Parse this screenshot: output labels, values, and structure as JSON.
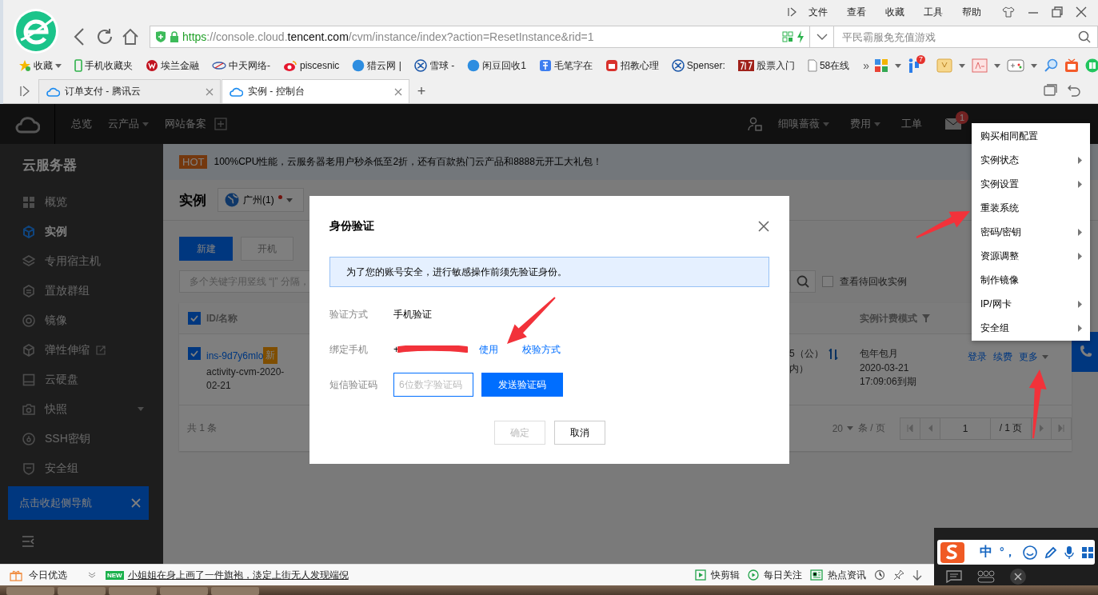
{
  "browser": {
    "menu": [
      "文件",
      "查看",
      "收藏",
      "工具",
      "帮助"
    ],
    "address": [
      {
        "kind": "scheme",
        "text": "https"
      },
      {
        "kind": "path",
        "text": "://console.cloud."
      },
      {
        "kind": "domain",
        "text": "tencent.com"
      },
      {
        "kind": "path",
        "text": "/cvm/instance/index?action=ResetInstance&rid=1"
      }
    ],
    "search": {
      "placeholder": "平民霸服免充值游戏"
    },
    "bookmarks": [
      {
        "label": "收藏"
      },
      {
        "label": "手机收藏夹"
      },
      {
        "label": "埃兰金融"
      },
      {
        "label": "中天网络-"
      },
      {
        "label": "piscesnic"
      },
      {
        "label": "猎云网 |"
      },
      {
        "label": "雪球 -"
      },
      {
        "label": "闲豆回收1"
      },
      {
        "label": "毛笔字在"
      },
      {
        "label": "招教心理"
      },
      {
        "label": "Spenser:"
      },
      {
        "label": "股票入门"
      },
      {
        "label": "58在线"
      }
    ],
    "bookmarks_more": "»",
    "app_badge": "7",
    "tabs": [
      {
        "label": "订单支付 - 腾讯云",
        "selected": false
      },
      {
        "label": "实例 - 控制台",
        "selected": true
      }
    ],
    "new_tab": "+"
  },
  "console": {
    "nav": [
      {
        "label": "总览",
        "dropdown": false
      },
      {
        "label": "云产品",
        "dropdown": true
      },
      {
        "label": "网站备案",
        "dropdown": false
      }
    ],
    "nav_right": [
      {
        "label": "细嗅蔷薇",
        "dropdown": true
      },
      {
        "label": "费用",
        "dropdown": true
      },
      {
        "label": "工单",
        "dropdown": false
      }
    ],
    "mail_badge": "1",
    "sidebar": {
      "title": "云服务器",
      "tooltip": "点击收起侧导航",
      "items": [
        {
          "label": "概览",
          "kind": "plain",
          "selected": false
        },
        {
          "label": "实例",
          "kind": "plain",
          "selected": true
        },
        {
          "label": "专用宿主机",
          "kind": "plain",
          "selected": false
        },
        {
          "label": "置放群组",
          "kind": "plain",
          "selected": false
        },
        {
          "label": "镜像",
          "kind": "plain",
          "selected": false
        },
        {
          "label": "弹性伸缩",
          "kind": "external",
          "selected": false
        },
        {
          "label": "云硬盘",
          "kind": "plain",
          "selected": false
        },
        {
          "label": "快照",
          "kind": "expandable",
          "selected": false
        },
        {
          "label": "SSH密钥",
          "kind": "plain",
          "selected": false
        },
        {
          "label": "安全组",
          "kind": "plain",
          "selected": false
        }
      ]
    },
    "banner": {
      "tag": "HOT",
      "text": "100%CPU性能，云服务器老用户秒杀低至2折，还有百款热门云产品和8888元开工大礼包！"
    },
    "page_title": "实例",
    "region": {
      "label": "广州(1)",
      "alert": true
    },
    "toolbar": [
      {
        "label": "新建",
        "kind": "primary"
      },
      {
        "label": "开机",
        "kind": "default"
      }
    ],
    "filter": {
      "placeholder": "多个关键字用竖线 “|” 分隔，"
    },
    "show_recycled": {
      "label": "查看待回收实例",
      "checked": false
    },
    "table": {
      "all_selected": true,
      "columns": [
        {
          "label": "ID/名称"
        },
        {
          "label": "实例计费模式",
          "filter": true
        }
      ],
      "rows": [
        {
          "selected": true,
          "id": "ins-9d7y6mlo",
          "badge": "新",
          "name": "activity-cvm-2020-02-21",
          "column_3": [
            "5（公）",
            "内）"
          ],
          "billing": "包年包月",
          "expiry_date": "2020-03-21",
          "expiry_time": "17:09:06到期",
          "actions": [
            "登录",
            "续费",
            "更多"
          ]
        }
      ]
    },
    "footer": {
      "total": "共 1 条",
      "page_size": "20",
      "page_size_unit": "条 / 页",
      "page": "1",
      "pages": "/ 1 页"
    }
  },
  "dialog": {
    "title": "身份验证",
    "notice": "为了您的账号安全，进行敏感操作前须先验证身份。",
    "method_label": "验证方式",
    "method": "手机验证",
    "phone_label": "绑定手机",
    "phone_visible": "+",
    "links": [
      "使用",
      "校验方式"
    ],
    "code_label": "短信验证码",
    "code_placeholder": "6位数字验证码",
    "send": "发送验证码",
    "buttons": [
      {
        "label": "确定",
        "disabled": true
      },
      {
        "label": "取消",
        "disabled": false
      }
    ]
  },
  "context_menu": [
    {
      "label": "购买相同配置",
      "submenu": false
    },
    {
      "label": "实例状态",
      "submenu": true
    },
    {
      "label": "实例设置",
      "submenu": true
    },
    {
      "label": "重装系统",
      "submenu": false
    },
    {
      "label": "密码/密钥",
      "submenu": true
    },
    {
      "label": "资源调整",
      "submenu": true
    },
    {
      "label": "制作镜像",
      "submenu": false
    },
    {
      "label": "IP/网卡",
      "submenu": true
    },
    {
      "label": "安全组",
      "submenu": true
    }
  ],
  "status_bar": {
    "left": "今日优选",
    "news_tag": "NEW",
    "headline": "小姐姐在身上画了一件旗袍，淡定上街无人发现端倪",
    "right": [
      "快剪辑",
      "每日关注",
      "热点资讯"
    ]
  },
  "ime": {
    "mode": "中",
    "punct": "°，"
  }
}
